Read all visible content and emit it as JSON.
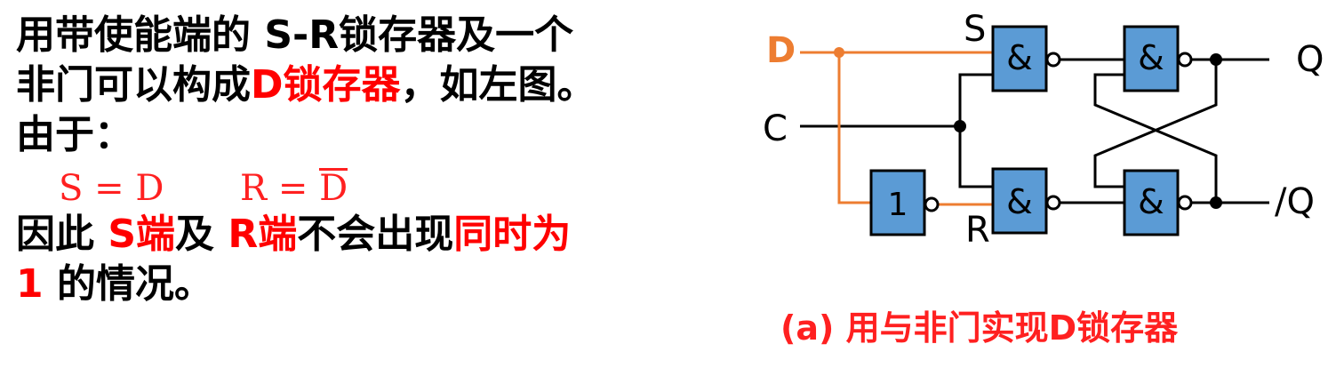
{
  "text": {
    "line1": {
      "bold": "S-R",
      "p1": "用带使能端的 ",
      "p2": "锁存器及一个"
    },
    "line2": {
      "p1": "非门可以构成",
      "red": "D锁存器",
      "p2": "，如左图。"
    },
    "line3": "由于：",
    "eq_s": "S = D",
    "eq_r_left": "R = ",
    "eq_r_bar": "D",
    "line5": {
      "p1": "因此 ",
      "red1": "S端",
      "p2": "及 ",
      "red2": "R端",
      "p3": "不会出现",
      "red3": "同时为"
    },
    "line6": {
      "red": "1",
      "p1": " 的情况。"
    }
  },
  "diagram": {
    "labels": {
      "D": "D",
      "C": "C",
      "S": "S",
      "R": "R",
      "Q": "Q",
      "Qbar": "/Q"
    },
    "gates": {
      "nand": "&",
      "not": "1"
    },
    "colors": {
      "gate_fill": "#5b9bd5",
      "d_wire": "#ed7d31",
      "wire": "#000000"
    }
  },
  "caption": "(a) 用与非门实现D锁存器"
}
